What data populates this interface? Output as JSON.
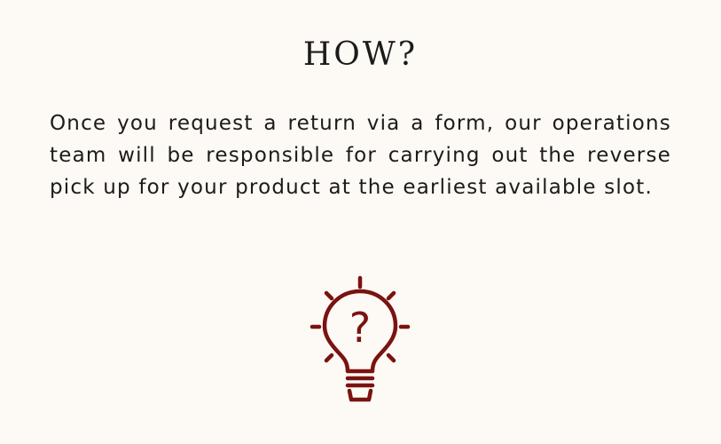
{
  "heading": "HOW?",
  "body": "Once you request a return via a form, our operations team will be responsible for carrying out the reverse pick up for your product at the earliest available slot.",
  "icon": {
    "name": "lightbulb-question-icon",
    "symbol": "?",
    "color": "#7a1212"
  },
  "colors": {
    "background": "#fdf9f4",
    "text": "#1b1b1b",
    "accent": "#7a1212"
  }
}
